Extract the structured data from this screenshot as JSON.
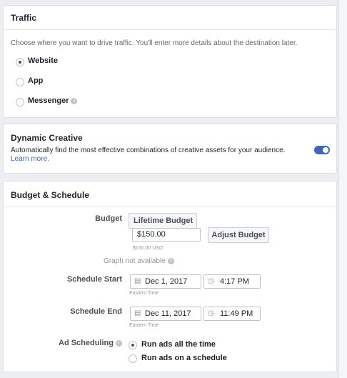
{
  "traffic": {
    "title": "Traffic",
    "description": "Choose where you want to drive traffic. You'll enter more details about the destination later.",
    "options": [
      {
        "label": "Website",
        "selected": true
      },
      {
        "label": "App",
        "selected": false
      },
      {
        "label": "Messenger",
        "selected": false
      }
    ]
  },
  "dynamic_creative": {
    "title": "Dynamic Creative",
    "description": "Automatically find the most effective combinations of creative assets for your audience.",
    "learn_more": "Learn more.",
    "enabled": true
  },
  "budget_schedule": {
    "title": "Budget & Schedule",
    "budget_label": "Budget",
    "budget_type": "Lifetime Budget",
    "budget_amount": "$150.00",
    "budget_usd_note": "$150.00 USD",
    "adjust_button": "Adjust Budget",
    "graph_note": "Graph not available",
    "schedule_start_label": "Schedule Start",
    "start_date": "Dec 1, 2017",
    "start_time": "4:17 PM",
    "start_timezone": "Eastern Time",
    "schedule_end_label": "Schedule End",
    "end_date": "Dec 11, 2017",
    "end_time": "11:49 PM",
    "end_timezone": "Eastern Time",
    "ad_scheduling_label": "Ad Scheduling",
    "ad_scheduling_options": [
      {
        "label": "Run ads all the time",
        "selected": true
      },
      {
        "label": "Run ads on a schedule",
        "selected": false
      }
    ]
  },
  "colors": {
    "accent": "#4267b2",
    "border": "#dddfe2",
    "background": "#eceef1"
  }
}
